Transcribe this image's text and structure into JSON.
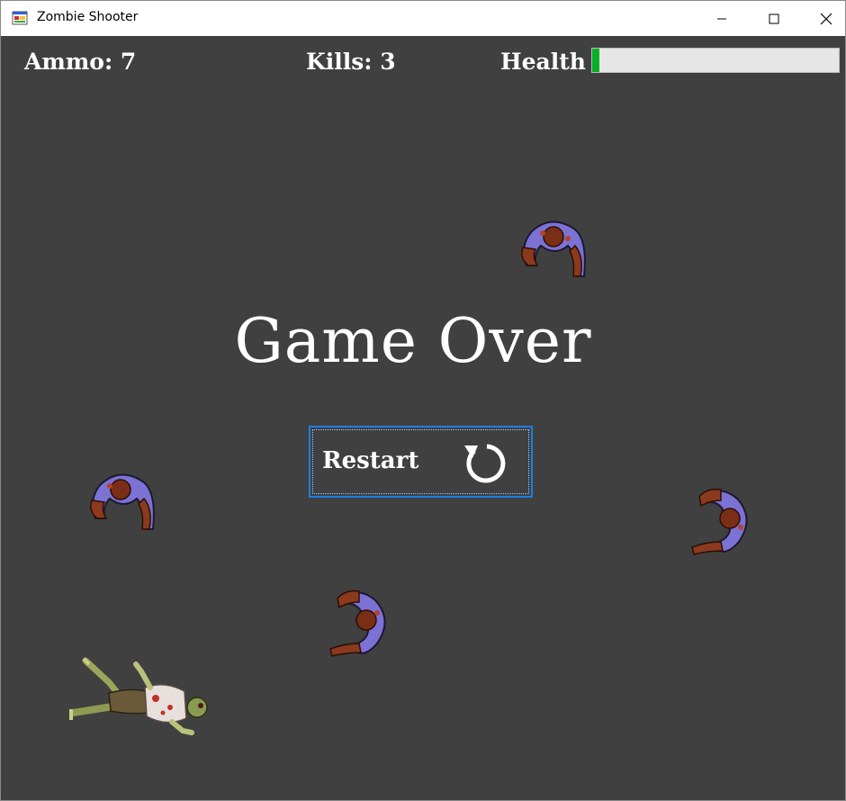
{
  "window": {
    "title": "Zombie Shooter"
  },
  "hud": {
    "ammo_text": "Ammo: 7",
    "kills_text": "Kills: 3",
    "health_label": "Health",
    "health_fraction": 0.03
  },
  "overlay": {
    "game_over_text": "Game Over",
    "restart_label": "Restart"
  },
  "colors": {
    "background": "#404040",
    "health_fill": "#06b025",
    "button_border": "#1e7ee6",
    "zombie_shirt": "#7b72d4",
    "zombie_skin": "#8b3a1e"
  },
  "icons": [
    "app-icon",
    "minimize-icon",
    "maximize-icon",
    "close-icon",
    "restart-icon",
    "zombie-icon",
    "player-icon"
  ]
}
